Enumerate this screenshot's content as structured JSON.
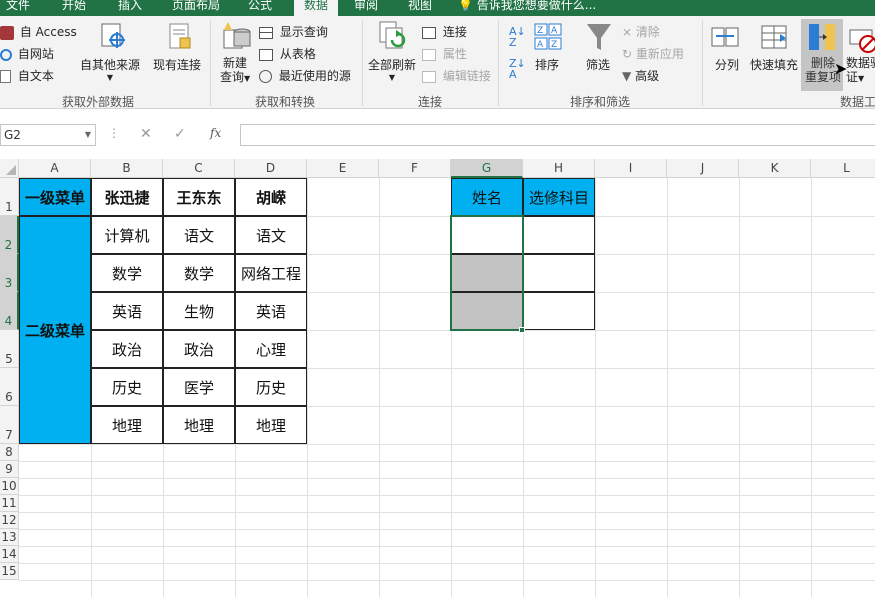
{
  "tabs": [
    "文件",
    "开始",
    "插入",
    "页面布局",
    "公式",
    "数据",
    "审阅",
    "视图"
  ],
  "tell_me": "告诉我您想要做什么...",
  "ribbon": {
    "get_external": {
      "access": "自 Access",
      "web": "自网站",
      "text": "自文本",
      "other_sources": "自其他来源",
      "existing_conn": "现有连接",
      "label": "获取外部数据"
    },
    "get_transform": {
      "new_query_line1": "新建",
      "new_query_line2": "查询",
      "show_queries": "显示查询",
      "from_table": "从表格",
      "recent_sources": "最近使用的源",
      "label": "获取和转换"
    },
    "connections": {
      "refresh_all": "全部刷新",
      "connections": "连接",
      "properties": "属性",
      "edit_links": "编辑链接",
      "label": "连接"
    },
    "sort_filter": {
      "sort": "排序",
      "filter": "筛选",
      "clear": "清除",
      "reapply": "重新应用",
      "advanced": "高级",
      "label": "排序和筛选"
    },
    "data_tools": {
      "text_to_columns": "分列",
      "flash_fill": "快速填充",
      "remove_dup_line1": "删除",
      "remove_dup_line2": "重复项",
      "validation_line1": "数据验",
      "validation_line2": "证",
      "label": "数据工"
    }
  },
  "formula_bar": {
    "name_box": "G2",
    "fx": "fx"
  },
  "columns": [
    "A",
    "B",
    "C",
    "D",
    "E",
    "F",
    "G",
    "H",
    "I",
    "J",
    "K",
    "L"
  ],
  "rows": [
    "1",
    "2",
    "3",
    "4",
    "5",
    "6",
    "7",
    "8",
    "9",
    "10",
    "11",
    "12",
    "13",
    "14",
    "15"
  ],
  "sheet": {
    "a1": "一级菜单",
    "a_merged": "二级菜单",
    "menu": [
      [
        "张迅捷",
        "王东东",
        "胡嵘"
      ],
      [
        "计算机",
        "语文",
        "语文"
      ],
      [
        "数学",
        "数学",
        "网络工程"
      ],
      [
        "英语",
        "生物",
        "英语"
      ],
      [
        "政治",
        "政治",
        "心理"
      ],
      [
        "历史",
        "医学",
        "历史"
      ],
      [
        "地理",
        "地理",
        "地理"
      ]
    ],
    "g1": "姓名",
    "h1": "选修科目"
  },
  "colors": {
    "excel_green": "#217346",
    "header_blue": "#00b0f0",
    "selection_grey": "#c3c3c3"
  }
}
